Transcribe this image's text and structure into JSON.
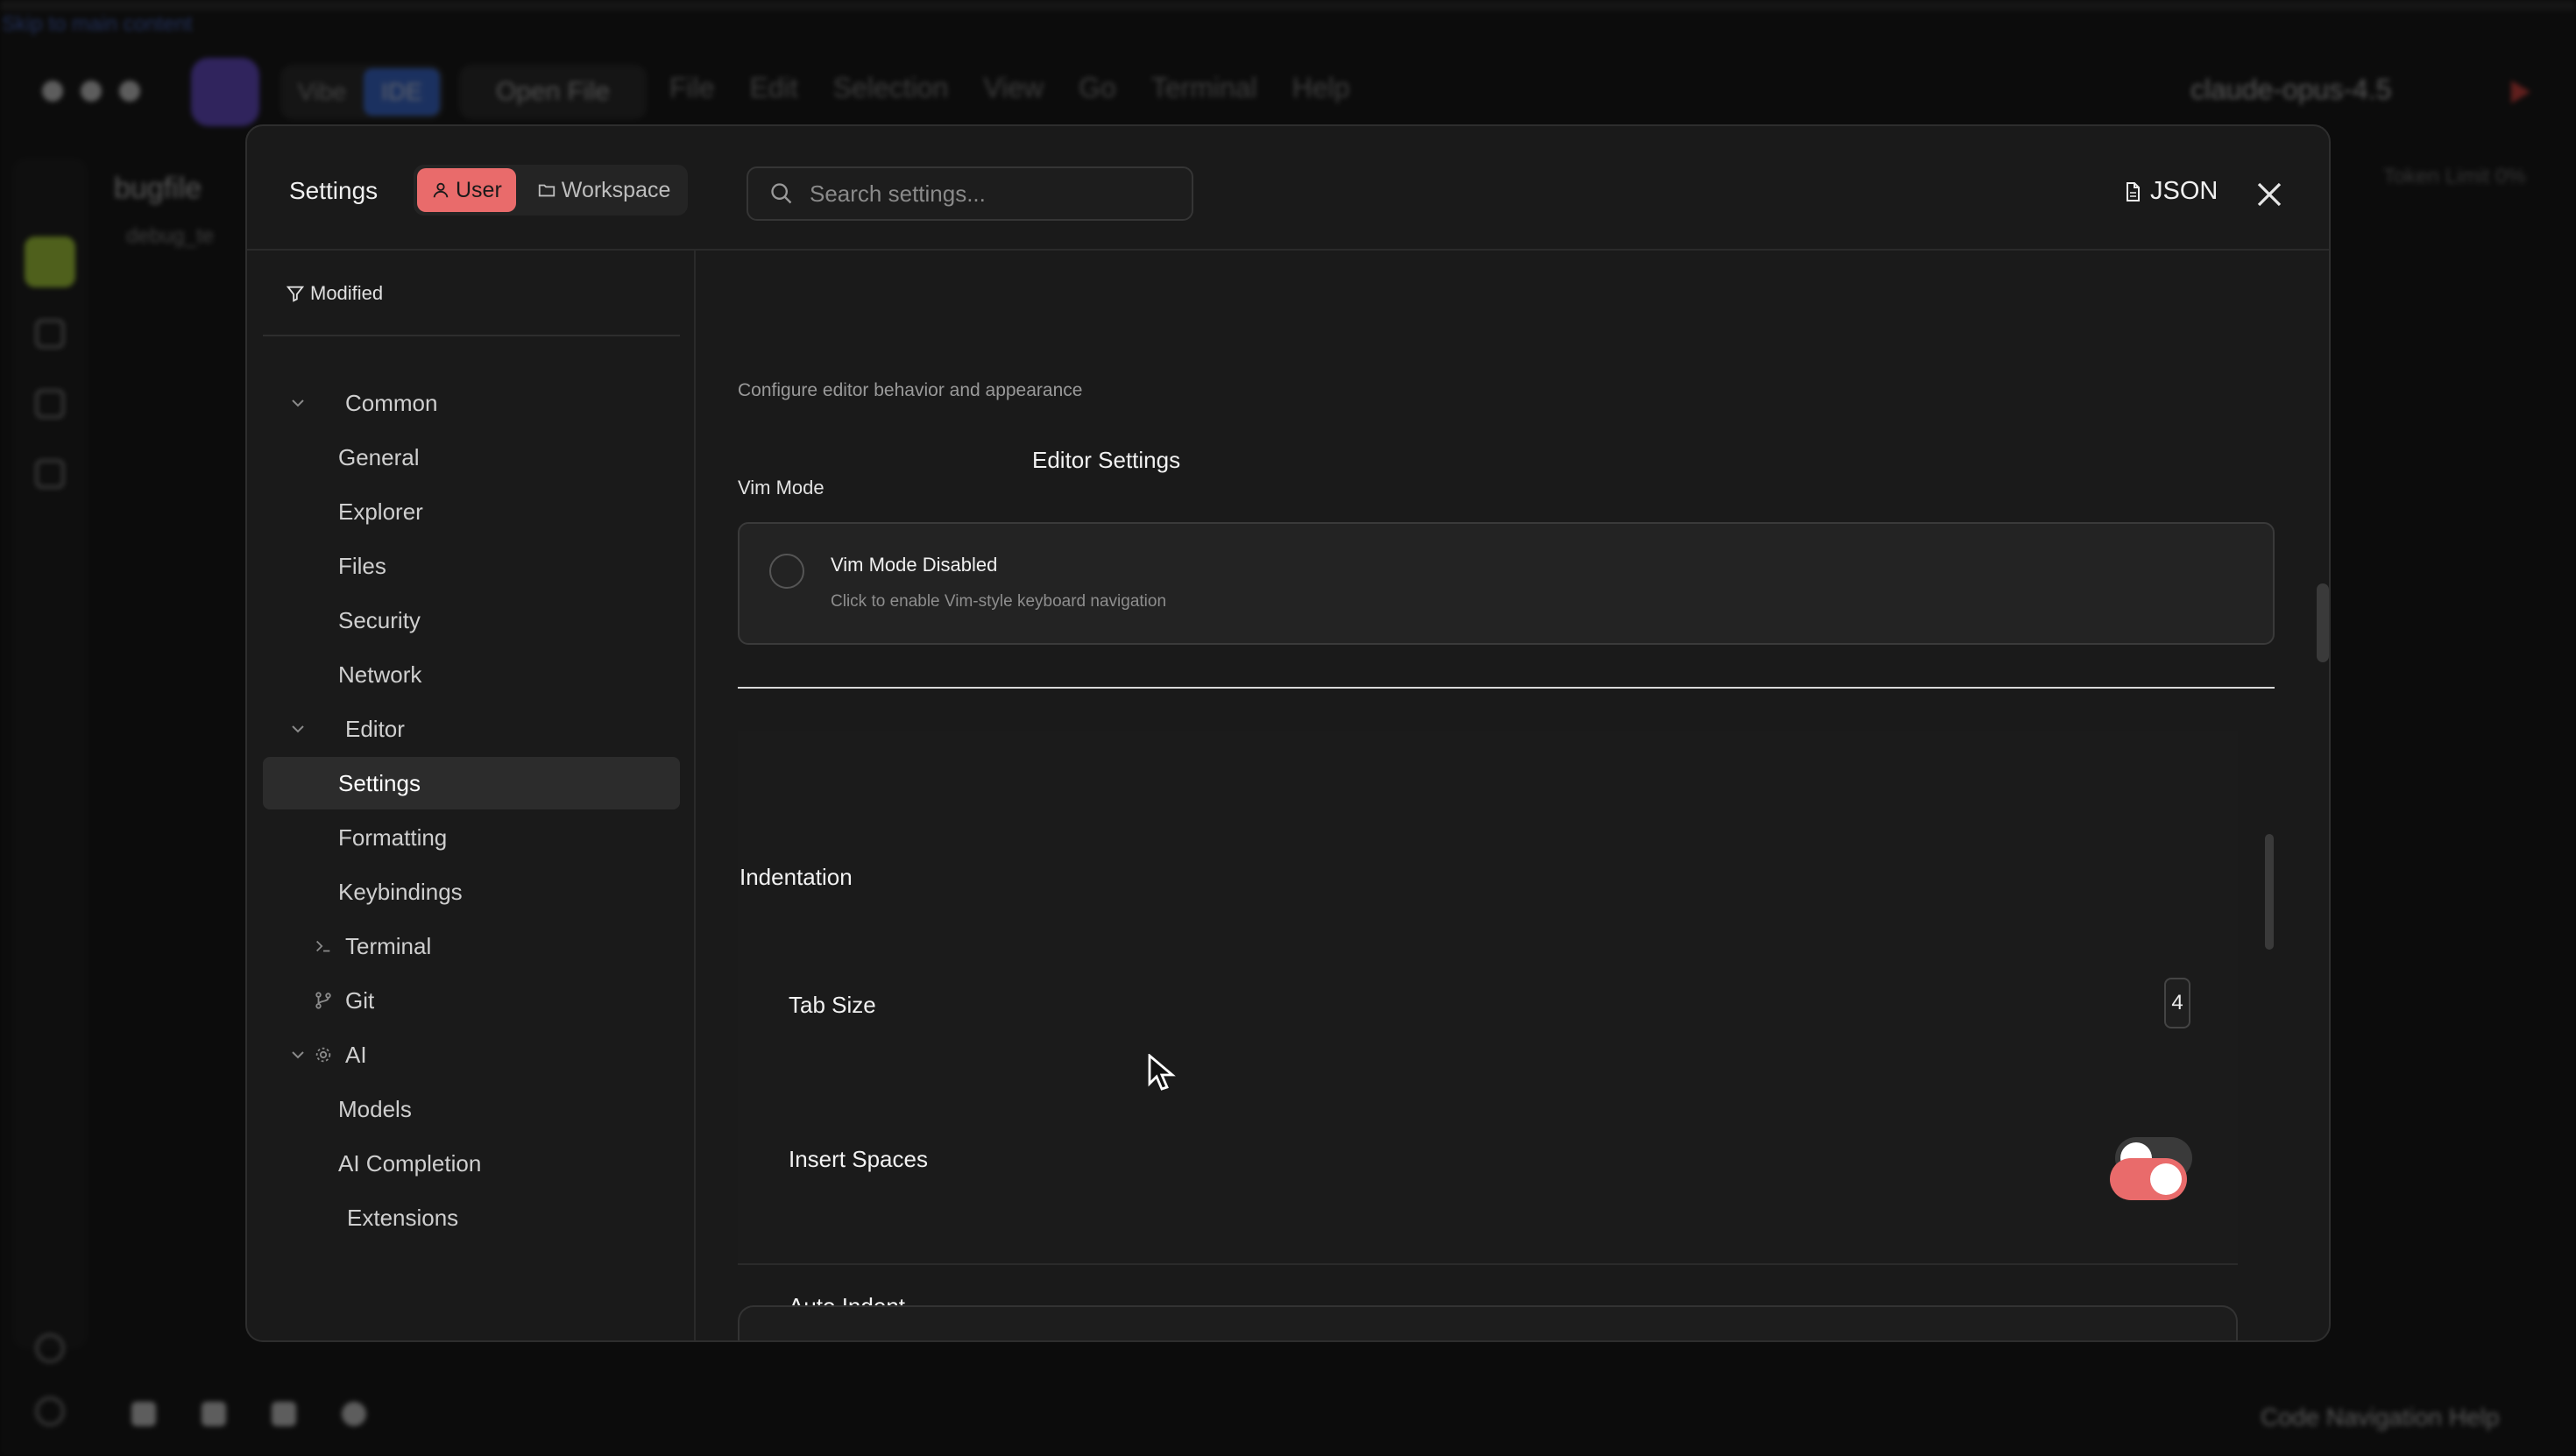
{
  "background_ide": {
    "skip_link": "Skip to main content",
    "mode_toggle": {
      "vibe": "Vibe",
      "ide": "IDE"
    },
    "open_file": "Open File",
    "menu": [
      "File",
      "Edit",
      "Selection",
      "View",
      "Go",
      "Terminal",
      "Help"
    ],
    "model": "claude-opus-4.5",
    "explorer_title": "bugfile",
    "explorer_file": "debug_te",
    "token_limit": "Token Limit  0%",
    "status_right": "Code Navigation Help"
  },
  "settings": {
    "title": "Settings",
    "scope_tabs": {
      "user": "User",
      "workspace": "Workspace"
    },
    "search_placeholder": "Search settings...",
    "json_label": "JSON",
    "modified_label": "Modified",
    "nav": {
      "common": "Common",
      "general": "General",
      "explorer": "Explorer",
      "files": "Files",
      "security": "Security",
      "network": "Network",
      "editor": "Editor",
      "settings": "Settings",
      "formatting": "Formatting",
      "keybindings": "Keybindings",
      "terminal": "Terminal",
      "git": "Git",
      "ai": "AI",
      "models": "Models",
      "ai_completion": "AI Completion",
      "extensions": "Extensions"
    },
    "content": {
      "section_title": "Editor Settings",
      "section_desc": "Configure editor behavior and appearance",
      "vim_label": "Vim Mode",
      "vim_title": "Vim Mode Disabled",
      "vim_desc": "Click to enable Vim-style keyboard navigation",
      "indentation_title": "Indentation",
      "tab_size_label": "Tab Size",
      "tab_size_value": "4",
      "insert_spaces_label": "Insert Spaces",
      "insert_spaces_on": false,
      "auto_indent_label": "Auto Indent",
      "auto_indent_on": true
    }
  },
  "colors": {
    "accent": "#e96b6b",
    "ide_blue": "#3b6fe0",
    "logo_purple": "#6b4fd8",
    "explorer_green": "#b7e23c"
  }
}
